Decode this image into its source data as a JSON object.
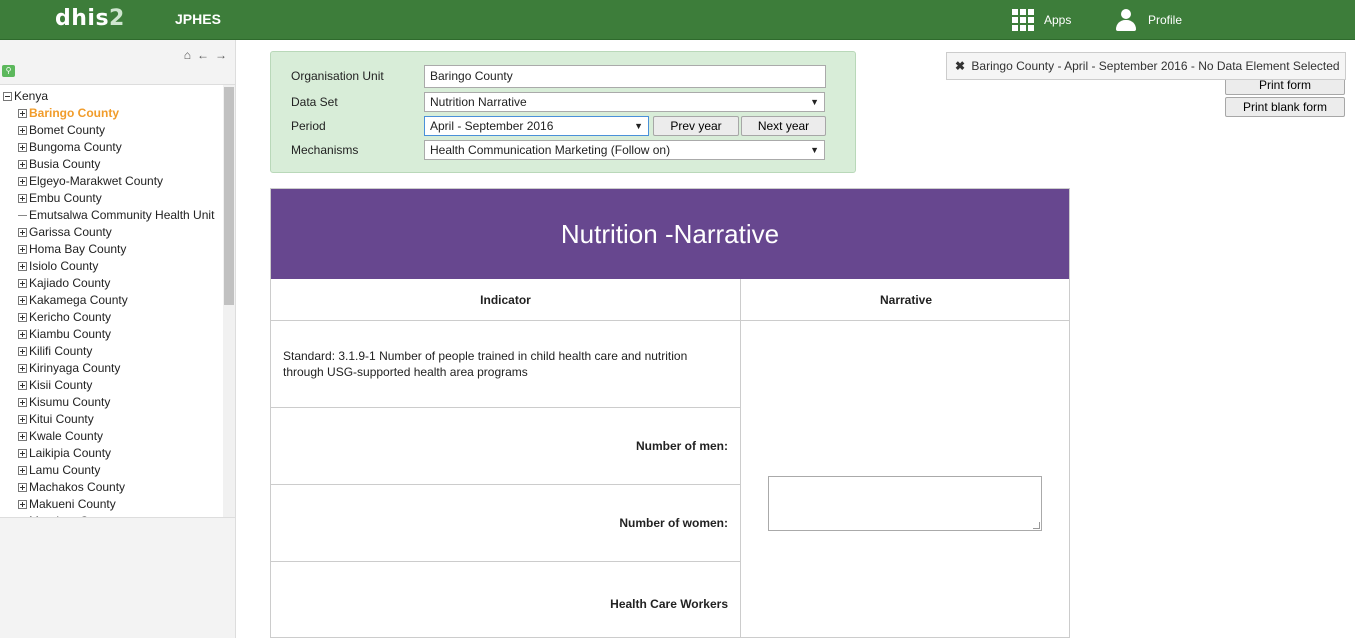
{
  "header": {
    "logo_main": "dhis",
    "logo_num": "2",
    "app_title": "JPHES",
    "apps_label": "Apps",
    "profile_label": "Profile"
  },
  "sidebar": {
    "nav_icons": [
      "home-icon",
      "back-arrow-icon",
      "forward-arrow-icon"
    ],
    "root": "Kenya",
    "items": [
      {
        "label": "Baringo County",
        "expandable": true,
        "selected": true
      },
      {
        "label": "Bomet County",
        "expandable": true
      },
      {
        "label": "Bungoma County",
        "expandable": true
      },
      {
        "label": "Busia County",
        "expandable": true
      },
      {
        "label": "Elgeyo-Marakwet County",
        "expandable": true
      },
      {
        "label": "Embu County",
        "expandable": true
      },
      {
        "label": "Emutsalwa Community Health Unit",
        "expandable": false
      },
      {
        "label": "Garissa County",
        "expandable": true
      },
      {
        "label": "Homa Bay County",
        "expandable": true
      },
      {
        "label": "Isiolo County",
        "expandable": true
      },
      {
        "label": "Kajiado County",
        "expandable": true
      },
      {
        "label": "Kakamega County",
        "expandable": true
      },
      {
        "label": "Kericho County",
        "expandable": true
      },
      {
        "label": "Kiambu County",
        "expandable": true
      },
      {
        "label": "Kilifi County",
        "expandable": true
      },
      {
        "label": "Kirinyaga County",
        "expandable": true
      },
      {
        "label": "Kisii County",
        "expandable": true
      },
      {
        "label": "Kisumu County",
        "expandable": true
      },
      {
        "label": "Kitui County",
        "expandable": true
      },
      {
        "label": "Kwale County",
        "expandable": true
      },
      {
        "label": "Laikipia County",
        "expandable": true
      },
      {
        "label": "Lamu County",
        "expandable": true
      },
      {
        "label": "Machakos County",
        "expandable": true
      },
      {
        "label": "Makueni County",
        "expandable": true
      },
      {
        "label": "Mandera County",
        "expandable": true
      }
    ]
  },
  "criteria": {
    "org_unit_label": "Organisation Unit",
    "org_unit_value": "Baringo County",
    "dataset_label": "Data Set",
    "dataset_value": "Nutrition Narrative",
    "period_label": "Period",
    "period_value": "April - September 2016",
    "prev_year": "Prev year",
    "next_year": "Next year",
    "mechanisms_label": "Mechanisms",
    "mechanisms_value": "Health Communication Marketing (Follow on)"
  },
  "notice": {
    "text": "Baringo County - April - September 2016 - No Data Element Selected"
  },
  "actions": {
    "print_form": "Print form",
    "print_blank_form": "Print blank form"
  },
  "form": {
    "title": "Nutrition -Narrative",
    "col_indicator": "Indicator",
    "col_narrative": "Narrative",
    "standard": "Standard: 3.1.9-1 Number of people trained in child health care and nutrition through USG-supported health area programs",
    "row_men": "Number of men",
    "row_women": "Number of women",
    "row_hcw": "Health Care Workers"
  },
  "colors": {
    "header_bg": "#3d7d3a",
    "form_title_bg": "#67478f",
    "criteria_bg": "#d8edd8",
    "selected_org": "#f19c2a"
  }
}
